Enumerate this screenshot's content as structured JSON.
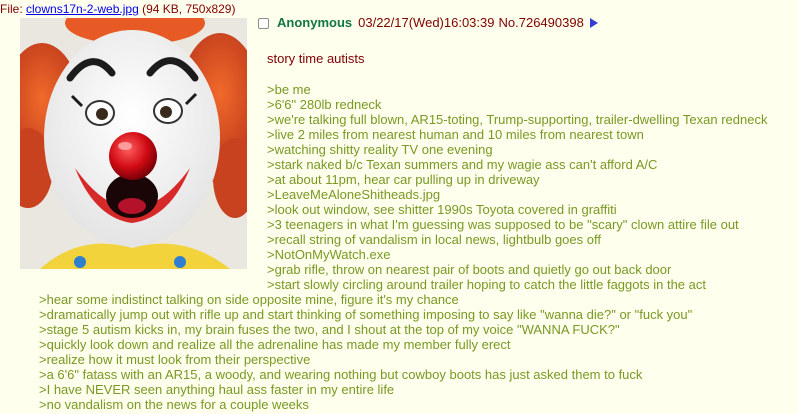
{
  "file": {
    "prefix": "File: ",
    "filename": "clowns17n-2-web.jpg",
    "meta": " (94 KB, 750x829)"
  },
  "post": {
    "name": "Anonymous",
    "datetime": "03/22/17(Wed)16:03:39",
    "number": "No.726490398"
  },
  "body": {
    "title": "story time autists",
    "lines": [
      ">be me",
      ">6'6\" 280lb redneck",
      ">we're talking full blown, AR15-toting, Trump-supporting, trailer-dwelling Texan redneck",
      ">live 2 miles from nearest human and 10 miles from nearest town",
      ">watching shitty reality TV one evening",
      ">stark naked b/c Texan summers and my wagie ass can't afford A/C",
      ">at about 11pm, hear car pulling up in driveway",
      ">LeaveMeAloneShitheads.jpg",
      ">look out window, see shitter 1990s Toyota covered in graffiti",
      ">3 teenagers in what I'm guessing was supposed to be \"scary\" clown attire file out",
      ">recall string of vandalism in local news, lightbulb goes off",
      ">NotOnMyWatch.exe",
      ">grab rifle, throw on nearest pair of boots and quietly go out back door",
      ">start slowly circling around trailer hoping to catch the little faggots in the act",
      ">hear some indistinct talking on side opposite mine, figure it's my chance",
      ">dramatically jump out with rifle up and start thinking of something imposing to say like \"wanna die?\" or \"fuck you\"",
      ">stage 5 autism kicks in, my brain fuses the two, and I shout at the top of my voice \"WANNA FUCK?\"",
      ">quickly look down and realize all the adrenaline has made my member fully erect",
      ">realize how it must look from their perspective",
      ">a 6'6\" fatass with an AR15, a woody, and wearing nothing but cowboy boots has just asked them to fuck",
      ">I have NEVER seen anything haul ass faster in my entire life",
      ">no vandalism on the news for a couple weeks"
    ]
  },
  "colors": {
    "background": "#ffffee",
    "text": "#800000",
    "greentext": "#789922",
    "name": "#117743",
    "link": "#0000ee"
  }
}
